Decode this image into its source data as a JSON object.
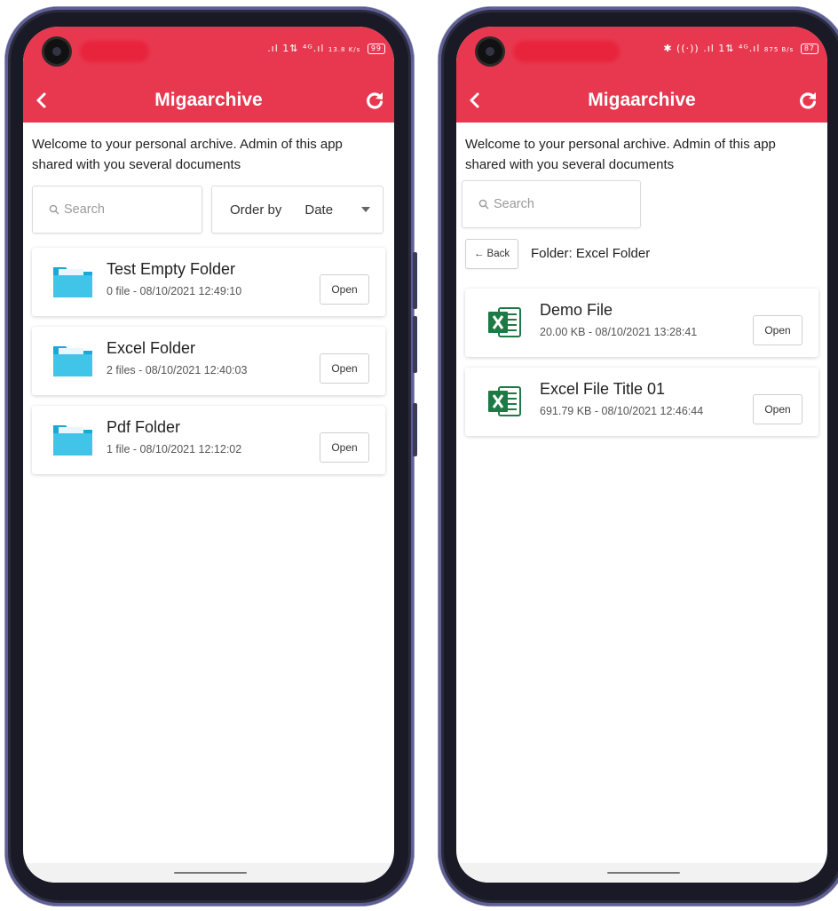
{
  "colors": {
    "accent": "#e8384f",
    "folder": "#40c4e8",
    "excel": "#1e7a44"
  },
  "left": {
    "status": {
      "signal_text": ".ıl 1⇅ ⁴ᴳ.ıl",
      "speed": "13.8 K/s",
      "battery": "99"
    },
    "appbar": {
      "title": "Migaarchive",
      "back_icon": "chevron-left-icon",
      "refresh_icon": "refresh-icon"
    },
    "welcome": "Welcome to your personal archive. Admin of this app shared with you several documents",
    "search": {
      "placeholder": "Search"
    },
    "order": {
      "label": "Order by",
      "value": "Date"
    },
    "folders": [
      {
        "name": "Test Empty Folder",
        "meta": "0 file - 08/10/2021 12:49:10",
        "action": "Open"
      },
      {
        "name": "Excel Folder",
        "meta": "2 files - 08/10/2021 12:40:03",
        "action": "Open"
      },
      {
        "name": "Pdf Folder",
        "meta": "1 file - 08/10/2021 12:12:02",
        "action": "Open"
      }
    ]
  },
  "right": {
    "status": {
      "signal_text": "✱ ((·)) .ıl 1⇅ ⁴ᴳ.ıl",
      "speed": "875 B/s",
      "battery": "87"
    },
    "appbar": {
      "title": "Migaarchive",
      "back_icon": "chevron-left-icon",
      "refresh_icon": "refresh-icon"
    },
    "welcome": "Welcome to your personal archive. Admin of this app shared with you several documents",
    "search": {
      "placeholder": "Search"
    },
    "back_button": "← Back",
    "folder_label": "Folder: Excel Folder",
    "files": [
      {
        "name": "Demo File",
        "meta": "20.00 KB - 08/10/2021 13:28:41",
        "action": "Open"
      },
      {
        "name": "Excel File Title 01",
        "meta": "691.79 KB - 08/10/2021 12:46:44",
        "action": "Open"
      }
    ]
  }
}
